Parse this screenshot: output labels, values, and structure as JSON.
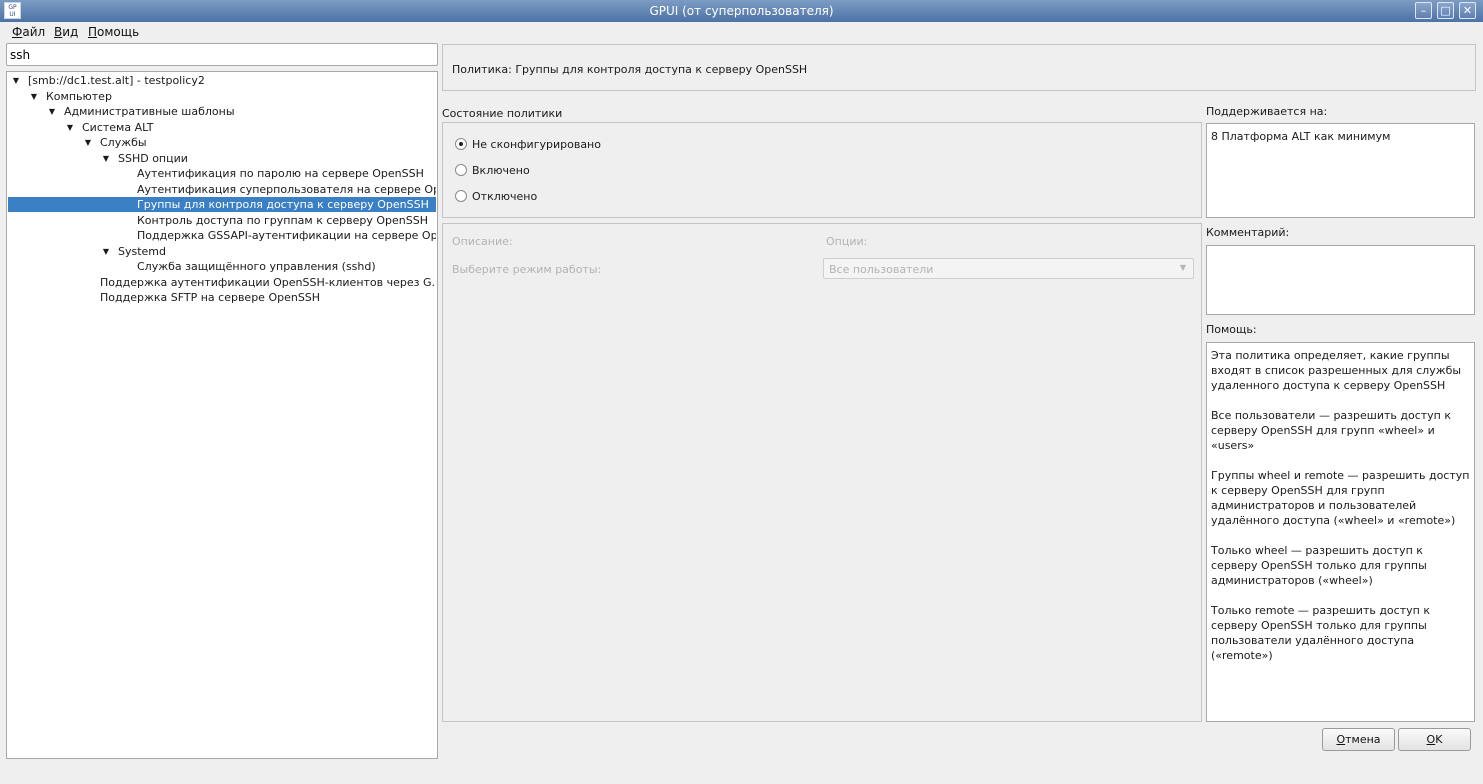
{
  "window": {
    "title": "GPUI (от суперпользователя)",
    "icon_text_top": "GP",
    "icon_text_bottom": "UI",
    "minimize_glyph": "–",
    "maximize_glyph": "□",
    "close_glyph": "✕"
  },
  "menu": {
    "file_mnemonic": "Ф",
    "file_rest": "айл",
    "view_mnemonic": "В",
    "view_rest": "ид",
    "help_mnemonic": "П",
    "help_rest": "омощь"
  },
  "search": {
    "value": "ssh"
  },
  "tree": {
    "items": [
      {
        "label": "[smb://dc1.test.alt] - testpolicy2",
        "arrow": "▼"
      },
      {
        "label": "Компьютер",
        "arrow": "▼"
      },
      {
        "label": "Административные шаблоны",
        "arrow": "▼"
      },
      {
        "label": "Система ALT",
        "arrow": "▼"
      },
      {
        "label": "Службы",
        "arrow": "▼"
      },
      {
        "label": "SSHD опции",
        "arrow": "▼"
      },
      {
        "label": "Аутентификация по паролю на сервере OpenSSH",
        "arrow": ""
      },
      {
        "label": "Аутентификация суперпользователя на сервере Ope...",
        "arrow": ""
      },
      {
        "label": "Группы для контроля доступа к серверу OpenSSH",
        "arrow": ""
      },
      {
        "label": "Контроль доступа по группам к серверу OpenSSH",
        "arrow": ""
      },
      {
        "label": "Поддержка GSSAPI-аутентификации на сервере Ope...",
        "arrow": ""
      },
      {
        "label": "Systemd",
        "arrow": "▼"
      },
      {
        "label": "Служба защищённого управления (sshd)",
        "arrow": ""
      },
      {
        "label": "Поддержка аутентификации OpenSSH-клиентов через G...",
        "arrow": ""
      },
      {
        "label": "Поддержка SFTP на сервере OpenSSH",
        "arrow": ""
      }
    ],
    "selected_index": 8
  },
  "policy": {
    "title": "Политика: Группы для контроля доступа к серверу OpenSSH",
    "state_label": "Состояние политики",
    "state_options": [
      "Не сконфигурировано",
      "Включено",
      "Отключено"
    ],
    "state_selected_index": 0,
    "description_label": "Описание:",
    "options_label": "Опции:",
    "mode_label": "Выберите режим работы:",
    "mode_value": "Все пользователи",
    "mode_caret": "▼"
  },
  "side": {
    "supported_label": "Поддерживается на:",
    "supported_value": "8 Платформа ALT как минимум",
    "comment_label": "Комментарий:",
    "comment_value": "",
    "help_label": "Помощь:",
    "help_paragraphs": [
      "Эта политика определяет, какие группы входят в список разрешенных для службы удаленного доступа к серверу OpenSSH",
      "Все пользователи — разрешить доступ к серверу OpenSSH для групп «wheel» и «users»",
      "Группы wheel и remote — разрешить доступ к серверу OpenSSH для групп администраторов и пользователей удалённого доступа («wheel» и «remote»)",
      "Только wheel — разрешить доступ к серверу OpenSSH только для группы администраторов («wheel»)",
      "Только remote — разрешить доступ к серверу OpenSSH только для группы пользователи удалённого доступа («remote»)"
    ]
  },
  "buttons": {
    "cancel_mnemonic": "О",
    "cancel_rest": "тмена",
    "ok_mnemonic": "O",
    "ok_rest": "K"
  }
}
